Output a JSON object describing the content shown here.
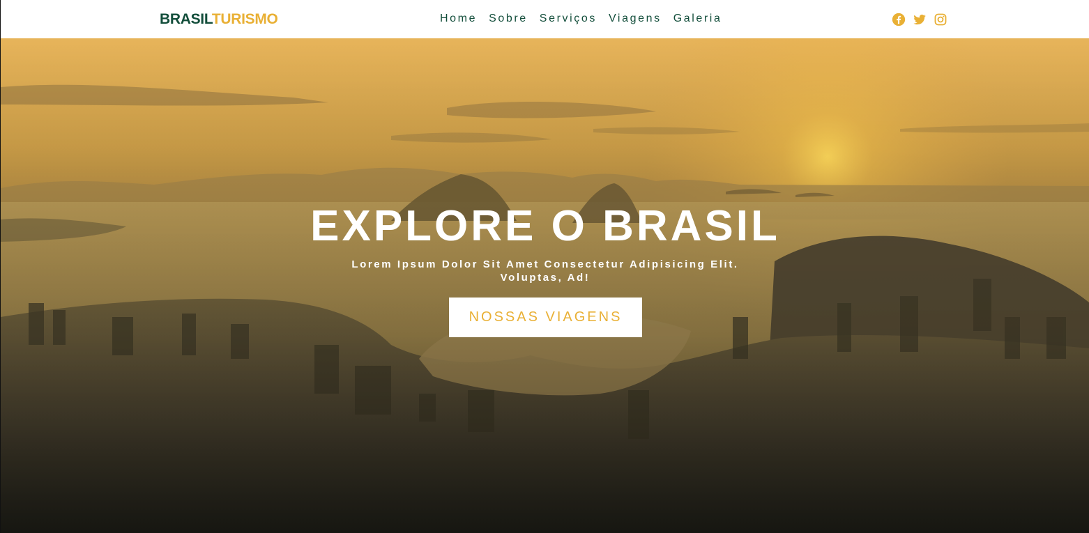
{
  "brand": {
    "part1": "BRASIL",
    "part2": "TURISMO"
  },
  "nav": {
    "links": [
      {
        "label": "Home"
      },
      {
        "label": "Sobre"
      },
      {
        "label": "Serviços"
      },
      {
        "label": "Viagens"
      },
      {
        "label": "Galeria"
      }
    ]
  },
  "socials": [
    {
      "icon": "facebook-icon"
    },
    {
      "icon": "twitter-icon"
    },
    {
      "icon": "instagram-icon"
    }
  ],
  "hero": {
    "title": "EXPLORE O BRASIL",
    "subtitle": "Lorem Ipsum Dolor Sit Amet Consectetur Adipisicing Elit. Voluptas, Ad!",
    "cta_label": "NOSSAS VIAGENS"
  },
  "colors": {
    "brand_green": "#134e3b",
    "brand_gold": "#e9b035",
    "social_gold": "#e9b035"
  }
}
